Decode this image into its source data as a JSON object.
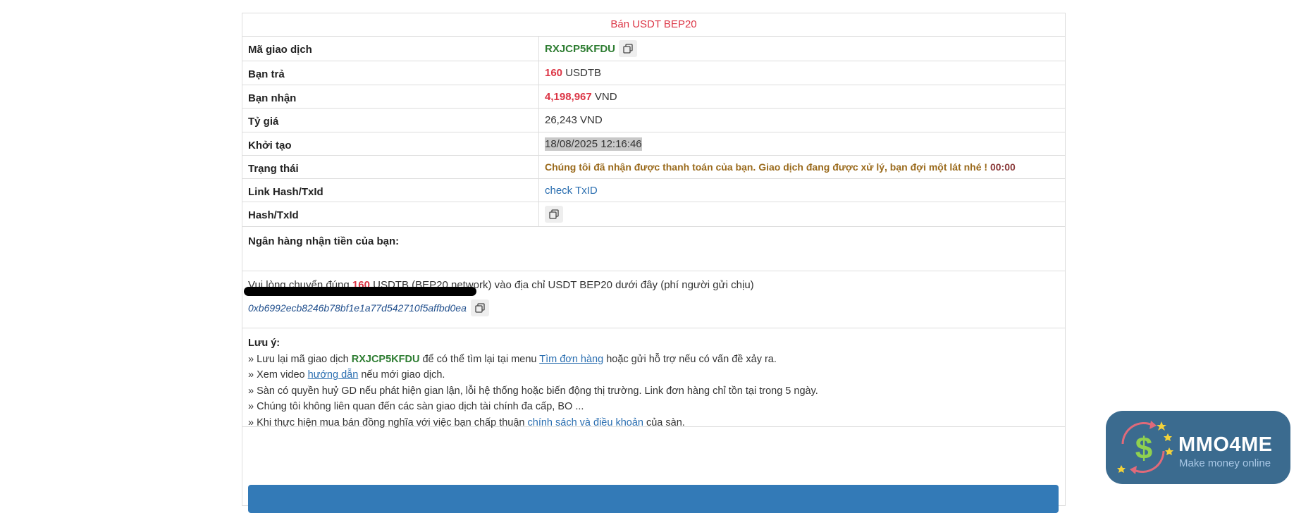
{
  "header": {
    "title": "Bán USDT BEP20"
  },
  "rows": {
    "txn_code": {
      "label": "Mã giao dịch",
      "value": "RXJCP5KFDU"
    },
    "you_pay": {
      "label": "Bạn trả",
      "amount": "160",
      "unit": "USDTB"
    },
    "you_receive": {
      "label": "Bạn nhận",
      "amount": "4,198,967",
      "unit": "VND"
    },
    "rate": {
      "label": "Tỷ giá",
      "value": "26,243 VND"
    },
    "created": {
      "label": "Khởi tạo",
      "value": "18/08/2025 12:16:46"
    },
    "status": {
      "label": "Trạng thái",
      "text": "Chúng tôi đã nhận được thanh toán của bạn. Giao dịch đang được xử lý, bạn đợi một lát nhé !",
      "timer": "00:00"
    },
    "link_hash": {
      "label": "Link Hash/TxId",
      "link_text": "check TxID"
    },
    "hash": {
      "label": "Hash/TxId"
    }
  },
  "bank": {
    "label": "Ngân hàng nhận tiền của bạn:"
  },
  "transfer": {
    "prefix": "Vui lòng chuyển đúng",
    "amount": "160",
    "suffix": "USDTB (BEP20 network) vào địa chỉ USDT BEP20 dưới đây (phí người gửi chịu)",
    "address": "0xb6992ecb8246b78bf1e1a77d542710f5affbd0ea"
  },
  "notes": {
    "title": "Lưu ý:",
    "line1_a": "» Lưu lại mã giao dịch",
    "line1_code": "RXJCP5KFDU",
    "line1_b": "để có thể tìm lại tại menu",
    "line1_link": "Tìm đơn hàng",
    "line1_c": "hoặc gửi hỗ trợ nếu có vấn đề xảy ra.",
    "line2_a": "» Xem video",
    "line2_link": "hướng dẫn",
    "line2_b": "nếu mới giao dịch.",
    "line3": "» Sàn có quyền huỷ GD nếu phát hiện gian lận, lỗi hệ thống hoặc biến động thị trường. Link đơn hàng chỉ tồn tại trong 5 ngày.",
    "line4": "» Chúng tôi không liên quan đến các sàn giao dịch tài chính đa cấp, BO ...",
    "line5_a": "» Khi thực hiện mua bán đồng nghĩa với việc bạn chấp thuận",
    "line5_link": "chính sách và điều khoản",
    "line5_b": "của sàn."
  },
  "badge": {
    "brand": "MMO4ME",
    "tagline": "Make money online"
  },
  "colors": {
    "accent_red": "#dc3545",
    "code_green": "#2e7d32",
    "link_blue": "#2a6eb0",
    "status_brown": "#9a6a1c",
    "primary_button": "#337ab7",
    "badge_bg": "#3b6b8f"
  },
  "icons": {
    "copy": "copy-icon",
    "logo": "dollar-cycle-icon"
  }
}
